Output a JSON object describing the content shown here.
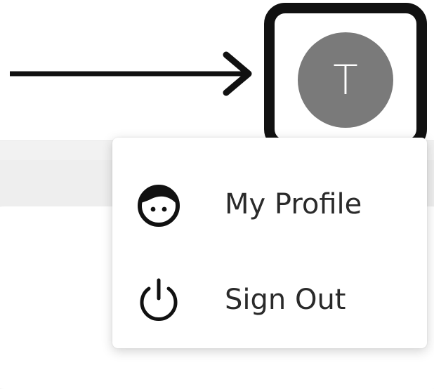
{
  "header": {
    "avatar": {
      "initial": "T",
      "color": "#7a7a7a"
    }
  },
  "annotation": {
    "highlight_color": "#111111",
    "arrow_icon": "right-arrow"
  },
  "menu": {
    "items": [
      {
        "label": "My Profile",
        "icon": "profile-face-icon"
      },
      {
        "label": "Sign Out",
        "icon": "power-icon"
      }
    ]
  }
}
